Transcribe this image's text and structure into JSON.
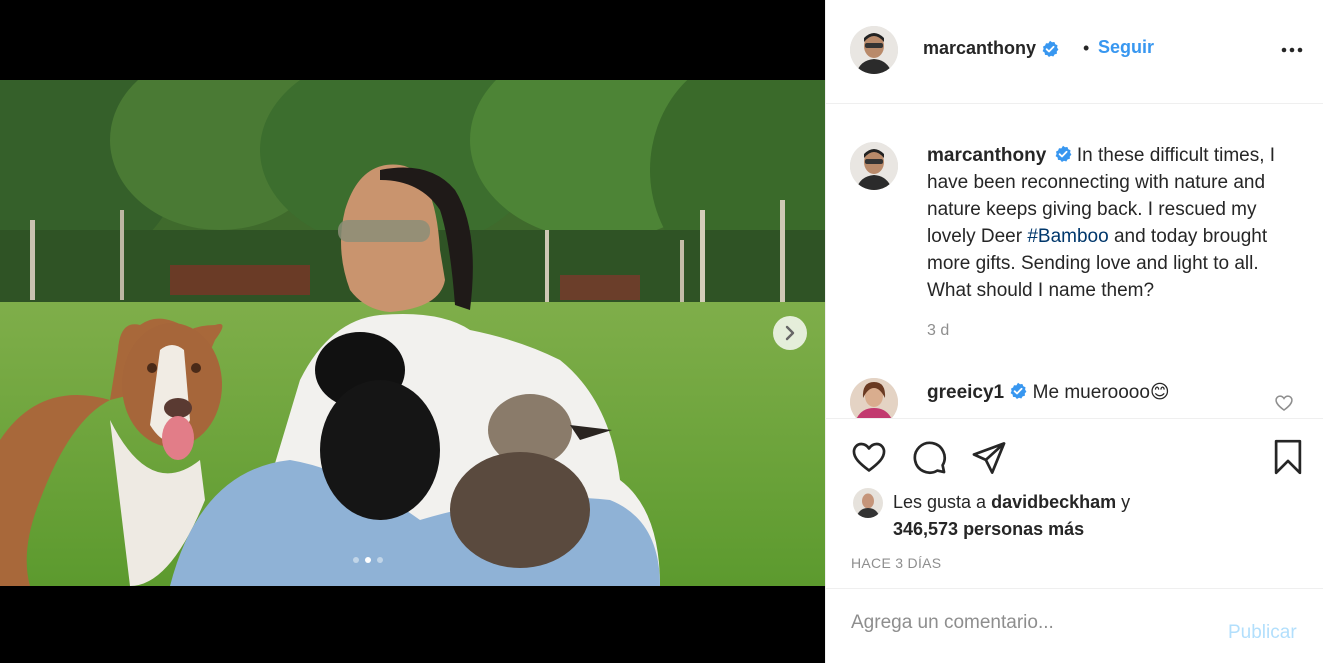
{
  "colors": {
    "accent": "#3897f0",
    "verified": "#3897f0",
    "hashtag": "#00376b",
    "muted": "#8e8e8e"
  },
  "header": {
    "username": "marcanthony",
    "separator": "•",
    "follow_label": "Seguir",
    "more_icon": "more-horizontal-icon"
  },
  "media": {
    "next_icon": "chevron-right-icon",
    "carousel_count": 3,
    "carousel_active": 2
  },
  "caption": {
    "username": "marcanthony",
    "text_before": " In these difficult times, I have been reconnecting with nature and nature keeps giving back. I rescued my lovely Deer ",
    "hashtag": "#Bamboo",
    "text_after": " and today brought more gifts. Sending love and light to all. What should I name them?",
    "time": "3 d"
  },
  "comment": {
    "username": "greeicy1",
    "text": " Me mueroooo",
    "emoji": "😊"
  },
  "actions": {
    "like_icon": "heart-icon",
    "comment_icon": "comment-icon",
    "share_icon": "share-icon",
    "save_icon": "bookmark-icon"
  },
  "likes": {
    "prefix": "Les gusta a ",
    "user": "davidbeckham",
    "conjunction": " y",
    "count_text": "346,573 personas más"
  },
  "timestamp": "HACE 3 DÍAS",
  "add_comment": {
    "placeholder": "Agrega un comentario...",
    "publish_label": "Publicar"
  }
}
